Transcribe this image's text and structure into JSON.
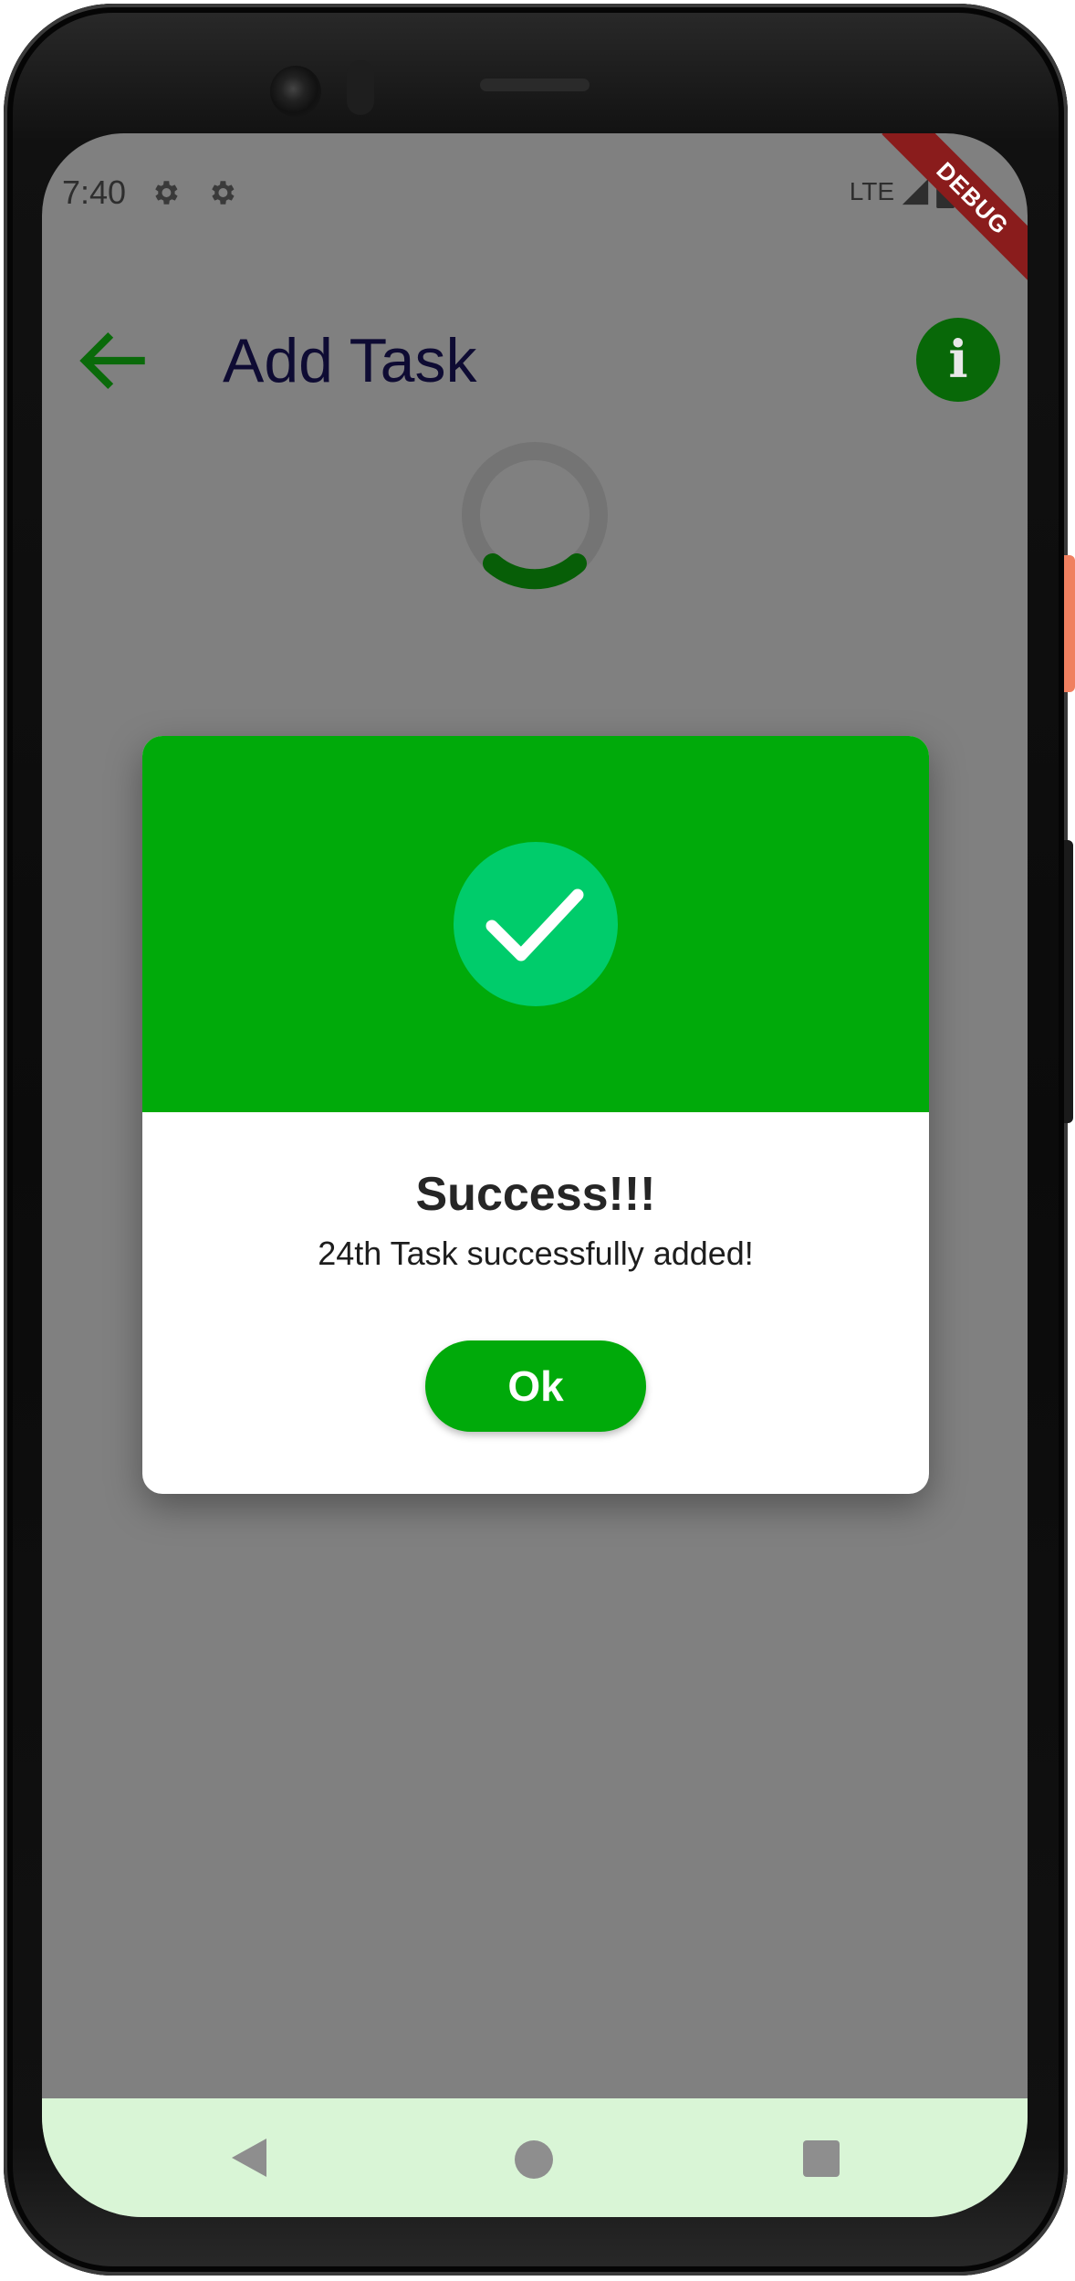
{
  "status_bar": {
    "time": "7:40",
    "network": "LTE",
    "debug_banner": "DEBUG"
  },
  "app_bar": {
    "title": "Add Task",
    "info_label": "i",
    "back_icon": "arrow-left-icon",
    "info_icon": "info-icon"
  },
  "loading": {
    "icon": "progress-spinner-icon"
  },
  "dialog": {
    "icon": "check-icon",
    "title": "Success!!!",
    "message": "24th Task successfully added!",
    "ok_label": "Ok"
  },
  "nav_bar": {
    "back_icon": "nav-back-icon",
    "home_icon": "nav-home-icon",
    "recents_icon": "nav-recents-icon"
  },
  "colors": {
    "accent_green": "#00aa0a",
    "dark_green": "#086808",
    "check_circle": "#00cc6b",
    "scrim": "#808080",
    "nav_bar_bg": "#d9f5d6",
    "title_text": "#0e0b33"
  }
}
